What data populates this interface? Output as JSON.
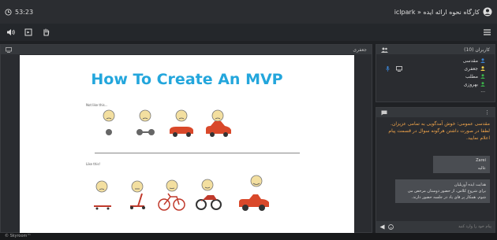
{
  "topbar": {
    "timer": "53:23",
    "title": "iclpark » کارگاه نحوه ارائه ایده"
  },
  "main": {
    "header_label": "جعفری"
  },
  "slide": {
    "title": "How To Create An MVP",
    "not_like": "Not like this...",
    "like": "Like this!"
  },
  "users": {
    "header": "کاربران (10)",
    "list": [
      "مقدسی",
      "جعفری",
      "مطلب",
      "بهروزی",
      "..."
    ]
  },
  "chat": {
    "intro": "مقدسی عمومی: خوش آمدگویی به تمامی عزیزان. لطفا در صورت داشتن هرگونه سوال در قسمت پیام اعلام نمایید.",
    "msg_name": "Zarei",
    "msg_text": "عالیه",
    "msg2_title": "هدایت ایده آوریلیان",
    "msg2_text": "برای شروع کلاس، از حضور دوستان مرخص می شوم. همکار پر فای یاد در جلسه حضور دارند.",
    "input_placeholder": "پیام خود را وارد کنید"
  },
  "footer": {
    "text": "© Skyroom™"
  },
  "colors": {
    "accent": "#23a6dc",
    "chat_intro": "#f2a54a",
    "user_icon": "#3b82d0"
  }
}
